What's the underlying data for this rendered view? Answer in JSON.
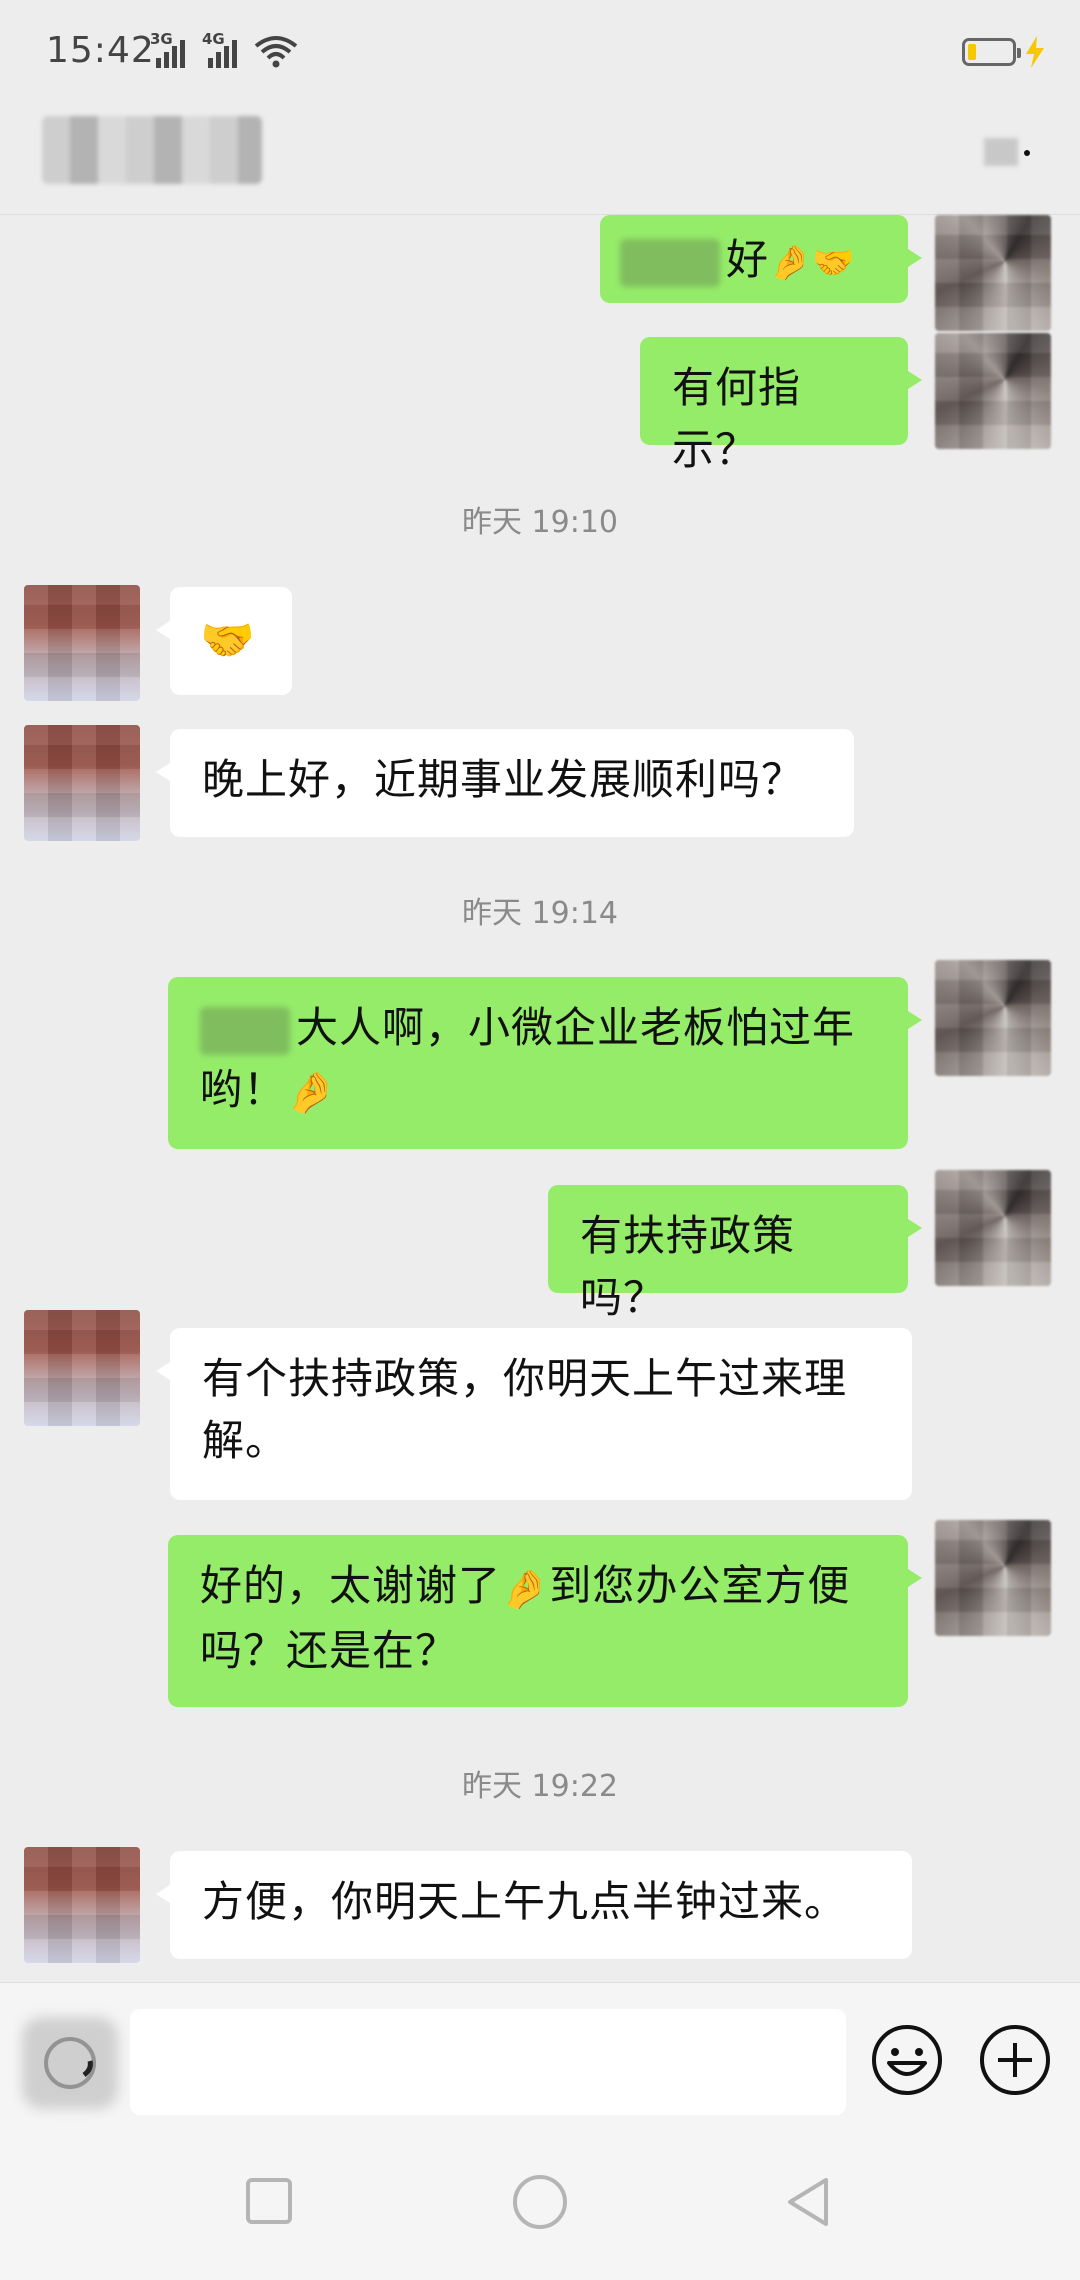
{
  "status_bar": {
    "time": "15:42",
    "net1": "3G",
    "net2": "4G",
    "icons": [
      "signal-3g-icon",
      "signal-4g-icon",
      "wifi-icon",
      "battery-icon",
      "charging-icon"
    ],
    "battery_level": 0.2
  },
  "title_bar": {
    "icons": [
      "more-icon"
    ]
  },
  "chat": {
    "messages": [
      {
        "from": "me",
        "text": "好"
      },
      {
        "from": "me",
        "text": "有何指示？"
      },
      {
        "timestamp": "昨天 19:10"
      },
      {
        "from": "other",
        "emoji": "handshake"
      },
      {
        "from": "other",
        "text": "晚上好，近期事业发展顺利吗？"
      },
      {
        "timestamp": "昨天 19:14"
      },
      {
        "from": "me",
        "text": "大人啊，小微企业老板怕过年哟！"
      },
      {
        "from": "me",
        "text": "有扶持政策吗？"
      },
      {
        "from": "other",
        "text": "有个扶持政策，你明天上午过来理解。"
      },
      {
        "from": "me",
        "text_a": "好的，太谢谢了",
        "text_b": "到您办公室方便吗？还是在？"
      },
      {
        "timestamp": "昨天 19:22"
      },
      {
        "from": "other",
        "text": "方便，你明天上午九点半钟过来。"
      }
    ]
  },
  "input_bar": {
    "icons": [
      "voice-icon",
      "emoji-icon",
      "plus-icon"
    ],
    "input_value": ""
  },
  "nav_bar": {
    "icons": [
      "recent-apps-icon",
      "home-icon",
      "back-icon"
    ]
  },
  "colors": {
    "background": "#ededed",
    "my_bubble": "#95ec69",
    "their_bubble": "#ffffff",
    "timestamp_text": "#8a8a8a"
  }
}
